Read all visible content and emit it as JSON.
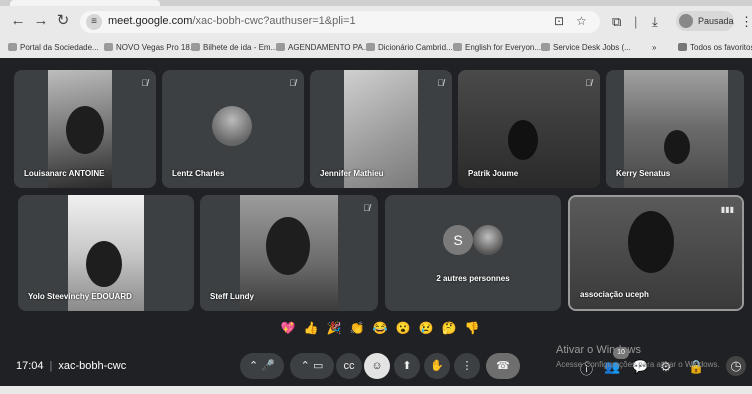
{
  "browser": {
    "url_host": "meet.google.com",
    "url_path": "/xac-bobh-cwc?authuser=1&pli=1",
    "profile_label": "Pausada",
    "back_icon": "arrow-left-icon",
    "forward_icon": "arrow-right-icon",
    "reload_icon": "reload-icon"
  },
  "bookmarks": {
    "items": [
      "Portal da Sociedade...",
      "NOVO Vegas Pro 18...",
      "Bilhete de ida - Em...",
      "AGENDAMENTO PA...",
      "Dicionário Cambrid...",
      "English for Everyon...",
      "Service Desk Jobs (..."
    ],
    "more": "»",
    "all_label": "Todos os favoritos"
  },
  "participants": [
    {
      "name": "Louisanarc ANTOINE",
      "muted": true
    },
    {
      "name": "Lentz Charles",
      "muted": true
    },
    {
      "name": "Jennifer Mathieu",
      "muted": true
    },
    {
      "name": "Patrik Joume",
      "muted": true
    },
    {
      "name": "Kerry Senatus",
      "muted": false
    },
    {
      "name": "Yolo Steevinchy EDOUARD",
      "muted": false
    },
    {
      "name": "Steff Lundy",
      "muted": true
    },
    {
      "name": "2 autres personnes",
      "avatar_letter": "S"
    },
    {
      "name": "associação uceph",
      "speaking": true
    }
  ],
  "reactions": [
    "💖",
    "👍",
    "🎉",
    "👏",
    "😂",
    "😮",
    "😢",
    "🤔",
    "👎"
  ],
  "meeting": {
    "time": "17:04",
    "code": "xac-bobh-cwc"
  },
  "watermark": {
    "line1": "Ativar o Windows",
    "line2": "Acesse Configurações para ativar o Windows.",
    "badge": "10"
  },
  "colors": {
    "background": "#202124",
    "tile": "#3c4043",
    "chrome": "#e9e9e9"
  }
}
